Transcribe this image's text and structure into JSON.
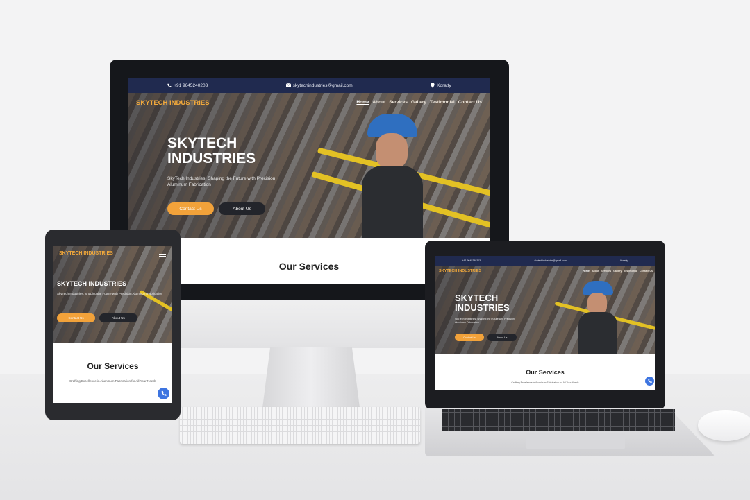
{
  "site": {
    "phone": "+91 9645240203",
    "email": "skytechindustries@gmail.com",
    "location": "Koratty",
    "brand": "SKYTECH INDUSTRIES",
    "nav": [
      "Home",
      "About",
      "Services",
      "Gallery",
      "Testimonial",
      "Contact Us"
    ],
    "hero_title": "SKYTECH INDUSTRIES",
    "hero_subtitle": "SkyTech Industries: Shaping the Future with Precision Aluminum Fabrication",
    "contact_button": "Contact Us",
    "about_button": "About Us",
    "services_heading": "Our Services",
    "services_tagline": "Crafting Excellence in Aluminum Fabrication for All Your Needs"
  },
  "colors": {
    "topbar": "#202a4f",
    "brand": "#f2a93b",
    "contact_button": "#f2a23a",
    "about_button": "#23252b"
  },
  "icons": [
    "phone-icon",
    "mail-icon",
    "location-pin-icon",
    "hamburger-menu-icon",
    "phone-call-fab-icon"
  ]
}
